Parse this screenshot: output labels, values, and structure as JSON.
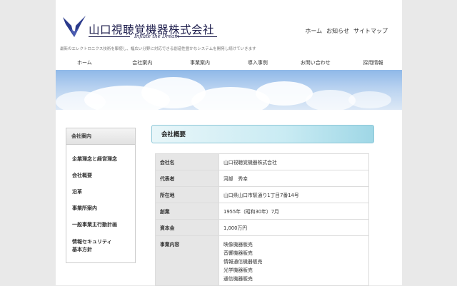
{
  "header": {
    "company_name": "山口視聴覚機器株式会社",
    "tagline_en": "Inflate the Dream",
    "description": "最新のエレクトロニクス技術を駆使し、幅広い分野に対応できる創造性豊かなシステムを開発し続けていきます",
    "util_nav": [
      "ホーム",
      "お知らせ",
      "サイトマップ"
    ]
  },
  "global_nav": [
    "ホーム",
    "会社案内",
    "事業案内",
    "導入事例",
    "お問い合わせ",
    "採用情報"
  ],
  "sidebar": {
    "heading": "会社案内",
    "items": [
      "企業理念と経営理念",
      "会社概要",
      "沿革",
      "事業所案内",
      "一般事業主行動計画",
      "情報セキュリティ",
      "基本方針"
    ]
  },
  "main": {
    "title": "会社概要",
    "rows": [
      {
        "label": "会社名",
        "value": "山口視聴覚機器株式会社"
      },
      {
        "label": "代表者",
        "value": "河部　秀幸"
      },
      {
        "label": "所在地",
        "value": "山口県山口市駅通り1丁目7番14号"
      },
      {
        "label": "創業",
        "value": "1955年（昭和30年）7月"
      },
      {
        "label": "資本金",
        "value": "1,000万円"
      },
      {
        "label": "事業内容",
        "values": [
          "映像機器販売",
          "音響機器販売",
          "情報通信機器販売",
          "光学機器販売",
          "通信機器販売"
        ]
      }
    ]
  },
  "colors": {
    "logo": "#2b3a8c",
    "title_bar": "#c9ebf3",
    "hero_sky": "#8fb8e8"
  }
}
